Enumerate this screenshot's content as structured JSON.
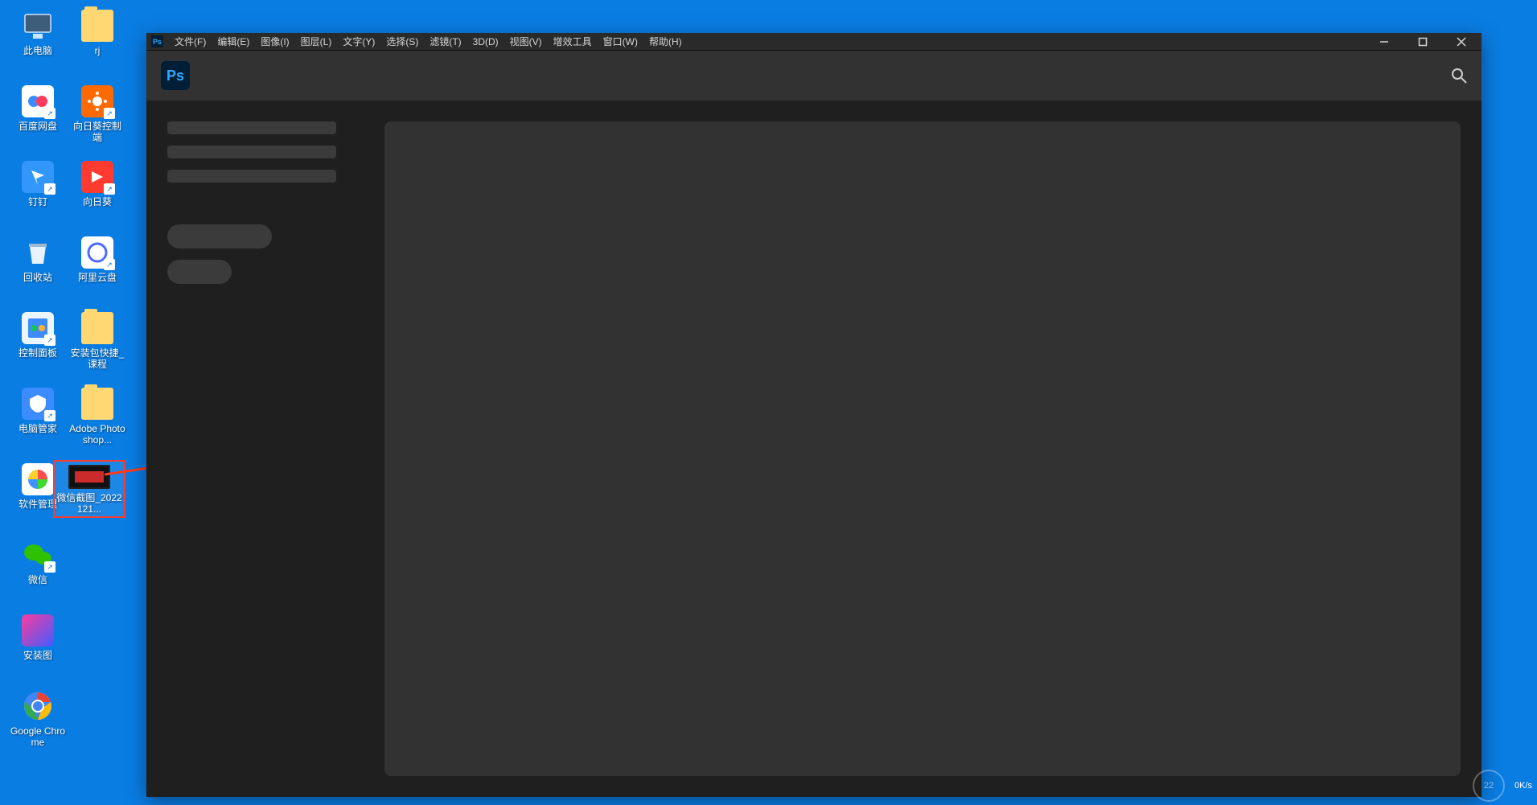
{
  "desktop_icons": {
    "col1": [
      {
        "label": "此电脑"
      },
      {
        "label": "百度网盘"
      },
      {
        "label": "钉钉"
      },
      {
        "label": "回收站"
      },
      {
        "label": "控制面板"
      },
      {
        "label": "电脑管家"
      },
      {
        "label": "软件管理"
      },
      {
        "label": "微信"
      },
      {
        "label": "安装图"
      },
      {
        "label": "Google Chrome"
      }
    ],
    "col2": [
      {
        "label": "rj"
      },
      {
        "label": "向日葵控制端"
      },
      {
        "label": "向日葵"
      },
      {
        "label": "阿里云盘"
      },
      {
        "label": "安装包快捷_课程"
      },
      {
        "label": "Adobe Photoshop..."
      },
      {
        "label": "微信截图_2022121..."
      }
    ]
  },
  "ps": {
    "logo_text": "Ps",
    "badge_text": "Ps",
    "menu": [
      "文件(F)",
      "编辑(E)",
      "图像(I)",
      "图层(L)",
      "文字(Y)",
      "选择(S)",
      "滤镜(T)",
      "3D(D)",
      "视图(V)",
      "增效工具",
      "窗口(W)",
      "帮助(H)"
    ]
  },
  "taskbar": {
    "time_big": "22",
    "net": "0K/s"
  }
}
